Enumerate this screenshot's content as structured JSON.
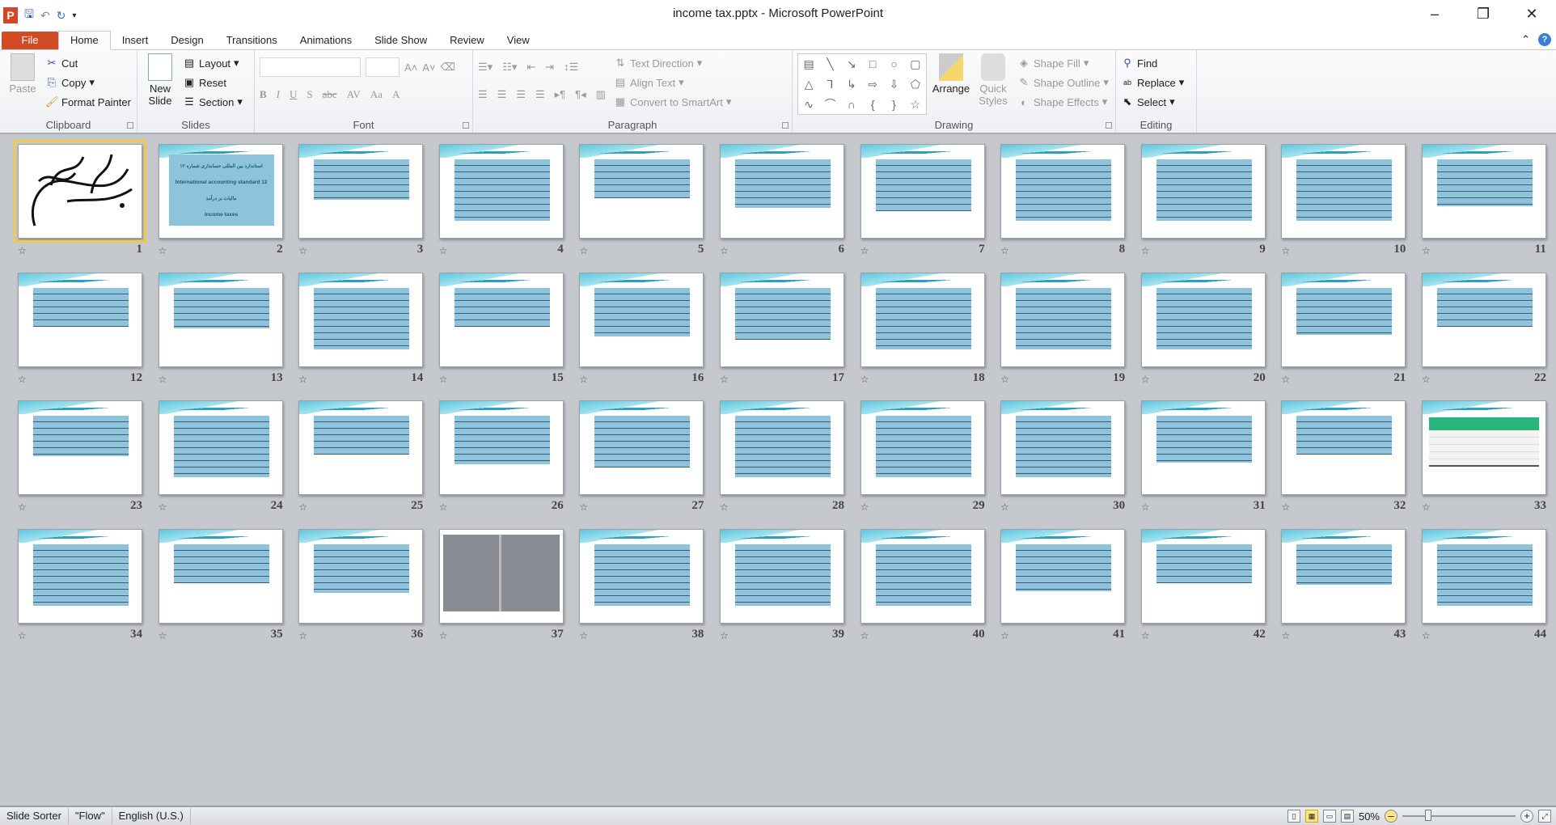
{
  "window": {
    "title": "income tax.pptx - Microsoft PowerPoint",
    "app_icon": "P"
  },
  "tabs": [
    "File",
    "Home",
    "Insert",
    "Design",
    "Transitions",
    "Animations",
    "Slide Show",
    "Review",
    "View"
  ],
  "ribbon": {
    "clipboard": {
      "label": "Clipboard",
      "paste": "Paste",
      "cut": "Cut",
      "copy": "Copy",
      "format_painter": "Format Painter"
    },
    "slides": {
      "label": "Slides",
      "new_slide": "New Slide",
      "layout": "Layout",
      "reset": "Reset",
      "section": "Section"
    },
    "font": {
      "label": "Font",
      "font_name": "",
      "font_size": ""
    },
    "paragraph": {
      "label": "Paragraph",
      "text_direction": "Text Direction",
      "align_text": "Align Text",
      "convert_smartart": "Convert to SmartArt"
    },
    "drawing": {
      "label": "Drawing",
      "arrange": "Arrange",
      "quick_styles": "Quick Styles",
      "shape_fill": "Shape Fill",
      "shape_outline": "Shape Outline",
      "shape_effects": "Shape Effects"
    },
    "editing": {
      "label": "Editing",
      "find": "Find",
      "replace": "Replace",
      "select": "Select"
    }
  },
  "slide2": {
    "line1": "استاندارد بین المللی حسابداری شماره ۱۲",
    "line2": "International accounting standard 12",
    "line3": "مالیات بر درآمد",
    "line4": "Income taxes"
  },
  "slides": {
    "count": 44,
    "selected": 1
  },
  "status": {
    "view": "Slide Sorter",
    "theme": "\"Flow\"",
    "language": "English (U.S.)",
    "zoom": "50%",
    "zoom_percent": 50
  },
  "colors": {
    "file_tab": "#d14c24",
    "slide_box": "#8ec3dc",
    "selection": "#f2c94c",
    "table_header": "#2ab57d"
  }
}
